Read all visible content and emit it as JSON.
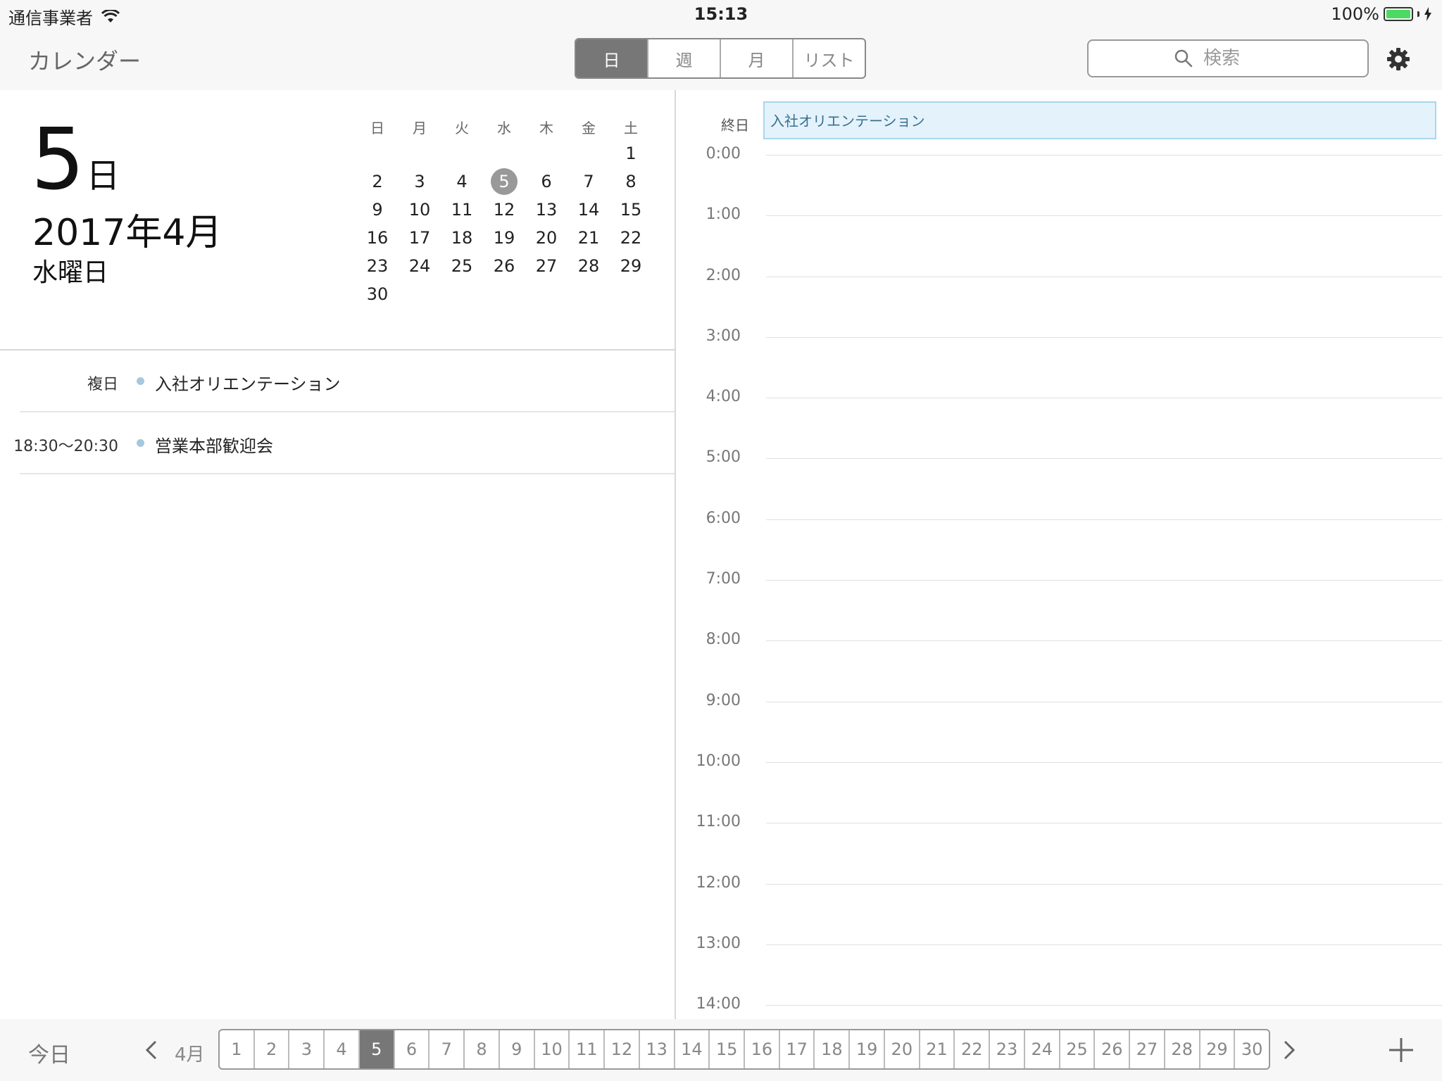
{
  "statusbar": {
    "carrier": "通信事業者",
    "time": "15:13",
    "battery": "100%"
  },
  "navbar": {
    "title": "カレンダー",
    "segments": [
      {
        "label": "日",
        "active": true
      },
      {
        "label": "週",
        "active": false
      },
      {
        "label": "月",
        "active": false
      },
      {
        "label": "リスト",
        "active": false
      }
    ],
    "search_placeholder": "検索"
  },
  "selected_date": {
    "day": "5",
    "day_unit": "日",
    "year_month": "2017年4月",
    "weekday": "水曜日"
  },
  "mini_calendar": {
    "weekdays": [
      "日",
      "月",
      "火",
      "水",
      "木",
      "金",
      "土"
    ],
    "first_weekday_index": 6,
    "days_in_month": 30,
    "selected_day": 5
  },
  "events": [
    {
      "time": "複日",
      "title": "入社オリエンテーション"
    },
    {
      "time": "18:30〜20:30",
      "title": "営業本部歓迎会"
    }
  ],
  "timeline": {
    "allday_label": "終日",
    "allday_event": "入社オリエンテーション",
    "hours": [
      "0:00",
      "1:00",
      "2:00",
      "3:00",
      "4:00",
      "5:00",
      "6:00",
      "7:00",
      "8:00",
      "9:00",
      "10:00",
      "11:00",
      "12:00",
      "13:00",
      "14:00"
    ]
  },
  "toolbar": {
    "today_label": "今日",
    "month_label": "4月",
    "days": [
      "1",
      "2",
      "3",
      "4",
      "5",
      "6",
      "7",
      "8",
      "9",
      "10",
      "11",
      "12",
      "13",
      "14",
      "15",
      "16",
      "17",
      "18",
      "19",
      "20",
      "21",
      "22",
      "23",
      "24",
      "25",
      "26",
      "27",
      "28",
      "29",
      "30"
    ],
    "active_day": "5"
  }
}
